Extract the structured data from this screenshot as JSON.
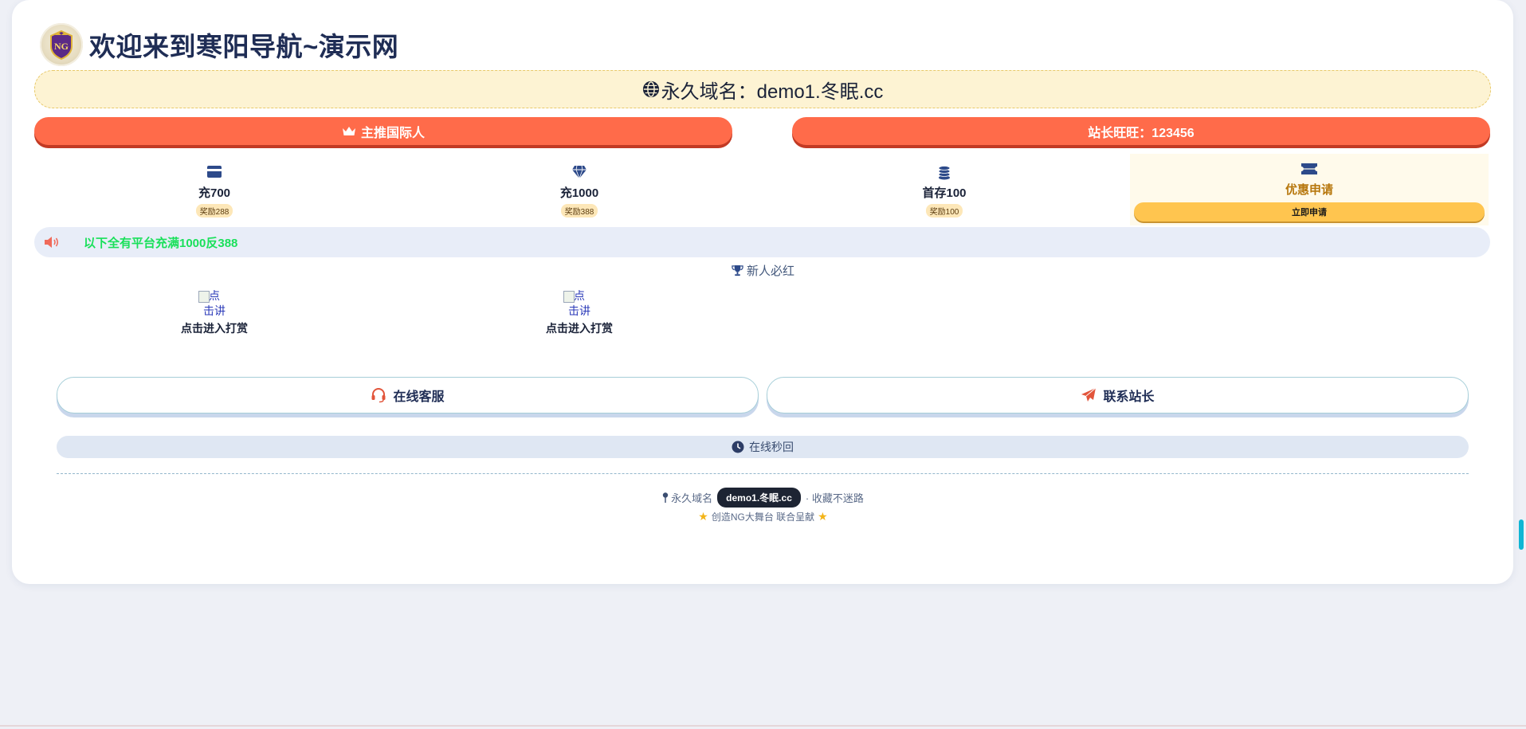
{
  "header": {
    "title": "欢迎来到寒阳导航~演示网",
    "logo_text": "NG"
  },
  "banner": {
    "text": "永久域名：demo1.冬眠.cc"
  },
  "buttons": {
    "left": "主推国际人",
    "right": "站长旺旺：123456"
  },
  "tiles": [
    {
      "icon": "card-icon",
      "label": "充700",
      "badge": "奖励288"
    },
    {
      "icon": "diamond-icon",
      "label": "充1000",
      "badge": "奖励388"
    },
    {
      "icon": "coins-icon",
      "label": "首存100",
      "badge": "奖励100"
    }
  ],
  "promo": {
    "icon": "ticket-icon",
    "label": "优惠申请",
    "button": "立即申请"
  },
  "notice": {
    "text": "以下全有平台充满1000反388"
  },
  "section": {
    "title": "新人必红"
  },
  "rewards": [
    {
      "alt_line1": "点",
      "alt_line2": "击讲",
      "label": "点击进入打赏"
    },
    {
      "alt_line1": "点",
      "alt_line2": "击讲",
      "label": "点击进入打赏"
    }
  ],
  "actions": {
    "service": "在线客服",
    "contact": "联系站长"
  },
  "online": {
    "text": "在线秒回"
  },
  "footer": {
    "domain_label": "永久域名",
    "domain_value": "demo1.冬眠.cc",
    "bookmark": "· 收藏不迷路",
    "credit": "创造NG大舞台 联合呈献"
  },
  "colors": {
    "accent_red": "#ff6b4a",
    "promo_yellow": "#ffc54f",
    "notice_green": "#19e05a",
    "banner_bg": "#fdf3d3"
  }
}
